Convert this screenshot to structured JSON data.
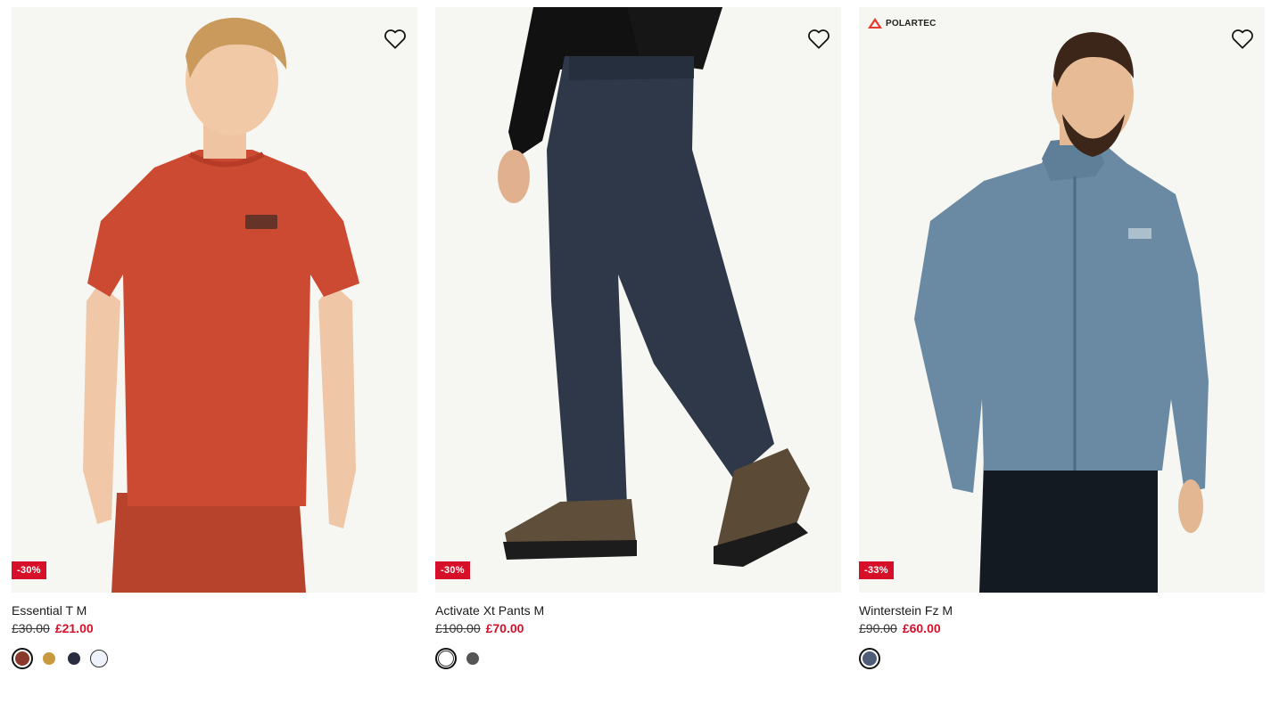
{
  "products": [
    {
      "name": "Essential T M",
      "old_price": "£30.00",
      "new_price": "£21.00",
      "discount_badge": "-30%",
      "wishlist_icon": "heart-outline-icon",
      "image_description_icon": "product-image",
      "swatches": [
        {
          "color": "#8a3a2a",
          "selected": true
        },
        {
          "color": "#c99a3d",
          "selected": false
        },
        {
          "color": "#2a2d3f",
          "selected": false
        },
        {
          "color": "#eef3fb",
          "selected": false,
          "light": true
        }
      ]
    },
    {
      "name": "Activate Xt Pants M",
      "old_price": "£100.00",
      "new_price": "£70.00",
      "discount_badge": "-30%",
      "wishlist_icon": "heart-outline-icon",
      "image_description_icon": "product-image",
      "swatches": [
        {
          "color": "#ffffff",
          "selected": true,
          "light": true
        },
        {
          "color": "#555555",
          "selected": false
        }
      ]
    },
    {
      "name": "Winterstein Fz M",
      "old_price": "£90.00",
      "new_price": "£60.00",
      "discount_badge": "-33%",
      "brand_badge": "POLARTEC",
      "wishlist_icon": "heart-outline-icon",
      "image_description_icon": "product-image",
      "swatches": [
        {
          "color": "#4f5d78",
          "selected": true
        }
      ]
    }
  ],
  "colors": {
    "sale_red": "#d7102a",
    "image_bg": "#f6f6f2"
  }
}
